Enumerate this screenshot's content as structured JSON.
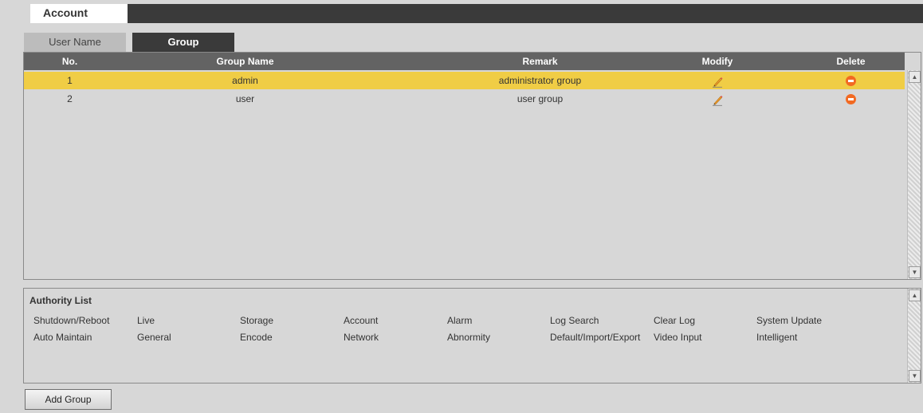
{
  "window": {
    "title": "Account"
  },
  "tabs": [
    {
      "label": "User Name",
      "active": false
    },
    {
      "label": "Group",
      "active": true
    }
  ],
  "table": {
    "columns": [
      "No.",
      "Group Name",
      "Remark",
      "Modify",
      "Delete"
    ],
    "rows": [
      {
        "no": "1",
        "name": "admin",
        "remark": "administrator group",
        "selected": true,
        "modify_icon": "pencil-icon",
        "delete_icon": "delete-icon"
      },
      {
        "no": "2",
        "name": "user",
        "remark": "user group",
        "selected": false,
        "modify_icon": "pencil-icon",
        "delete_icon": "delete-icon"
      }
    ]
  },
  "authority": {
    "title": "Authority List",
    "items": [
      [
        "Shutdown/Reboot",
        "Live",
        "Storage",
        "Account",
        "Alarm",
        "Log Search",
        "Clear Log",
        "System Update"
      ],
      [
        "Auto Maintain",
        "General",
        "Encode",
        "Network",
        "Abnormity",
        "Default/Import/Export",
        "Video Input",
        "Intelligent"
      ]
    ]
  },
  "buttons": {
    "add_group": "Add Group"
  },
  "colors": {
    "selected_row": "#f0cd45",
    "header_bg": "#636363",
    "delete_icon": "#f26a22",
    "active_tab": "#3a3a3a"
  }
}
